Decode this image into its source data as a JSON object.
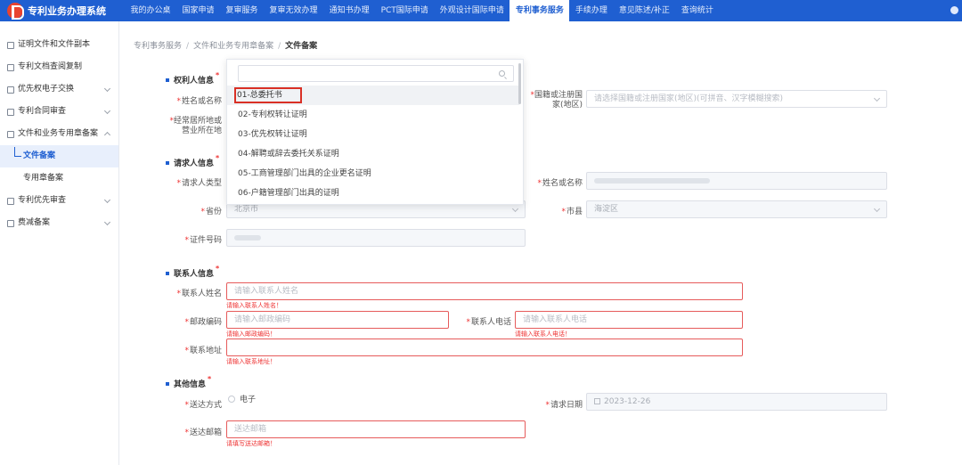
{
  "app": {
    "title": "专利业务办理系统"
  },
  "nav": [
    "我的办公桌",
    "国家申请",
    "复审服务",
    "复审无效办理",
    "通知书办理",
    "PCT国际申请",
    "外观设计国际申请",
    "专利事务服务",
    "手续办理",
    "意见陈述/补正",
    "查询统计"
  ],
  "nav_active_index": 7,
  "sidebar": {
    "items": [
      {
        "label": "证明文件和文件副本"
      },
      {
        "label": "专利文档查阅复制"
      },
      {
        "label": "优先权电子交换"
      },
      {
        "label": "专利合同审查"
      },
      {
        "label": "文件和业务专用章备案"
      },
      {
        "label": "专利优先审查"
      },
      {
        "label": "费减备案"
      }
    ],
    "subitems": [
      {
        "label": "文件备案"
      },
      {
        "label": "专用章备案"
      }
    ]
  },
  "breadcrumb": {
    "part1": "专利事务服务",
    "part2": "文件和业务专用章备案",
    "current": "文件备案"
  },
  "sections": {
    "rights_holder": "权利人信息",
    "requester": "请求人信息",
    "contact": "联系人信息",
    "other": "其他信息"
  },
  "rights": {
    "name_label": "姓名或名称",
    "nationality_label_1": "国籍或注册国",
    "nationality_label_2": "家(地区)",
    "nationality_placeholder": "请选择国籍或注册国家(地区)(可拼音、汉字模糊搜索)",
    "residence_label_1": "经常居所地或",
    "residence_label_2": "营业所在地"
  },
  "requester": {
    "type_label": "请求人类型",
    "name_label": "姓名或名称",
    "province_label": "省份",
    "province_value": "北京市",
    "city_label": "市县",
    "city_value": "海淀区",
    "id_label": "证件号码"
  },
  "contact": {
    "name_label": "联系人姓名",
    "name_placeholder": "请输入联系人姓名",
    "name_error": "请输入联系人姓名！",
    "zip_label": "邮政编码",
    "zip_placeholder": "请输入邮政编码",
    "zip_error": "请输入邮政编码！",
    "phone_label": "联系人电话",
    "phone_placeholder": "请输入联系人电话",
    "phone_error": "请输入联系人电话！",
    "addr_label": "联系地址",
    "addr_error": "请输入联系地址！"
  },
  "other": {
    "delivery_label": "送达方式",
    "delivery_option": "电子",
    "date_label": "请求日期",
    "date_value": "2023-12-26",
    "email_label": "送达邮箱",
    "email_placeholder": "送达邮箱",
    "email_error": "请填写送达邮箱！"
  },
  "dropdown": {
    "options": [
      "01-总委托书",
      "02-专利权转让证明",
      "03-优先权转让证明",
      "04-解聘或辞去委托关系证明",
      "05-工商管理部门出具的企业更名证明",
      "06-户籍管理部门出具的证明"
    ]
  },
  "colors": {
    "primary": "#1f5fd1",
    "error": "#e33333",
    "highlight_box": "#d93025"
  }
}
